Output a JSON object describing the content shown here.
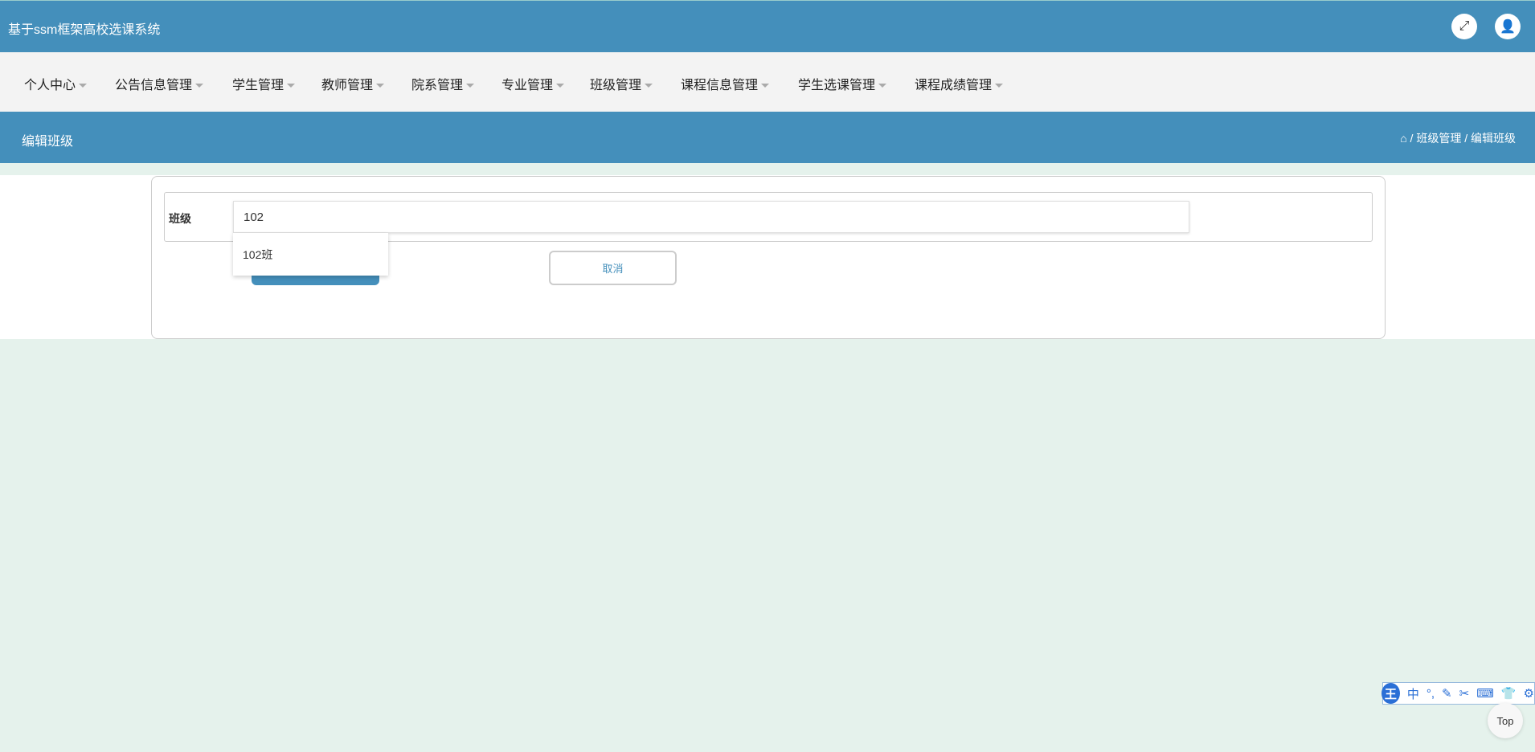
{
  "header": {
    "title": "基于ssm框架高校选课系统",
    "fullscreen_icon": "expand-icon",
    "user_icon": "user-icon"
  },
  "nav": [
    "个人中心",
    "公告信息管理",
    "学生管理",
    "教师管理",
    "院系管理",
    "专业管理",
    "班级管理",
    "课程信息管理",
    "学生选课管理",
    "课程成绩管理"
  ],
  "page": {
    "title": "编辑班级",
    "breadcrumb": [
      "班级管理",
      "编辑班级"
    ],
    "sep": "/"
  },
  "form": {
    "label": "班级",
    "value": "102",
    "suggestion": "102班",
    "cancel": "取消"
  },
  "ime": {
    "logo": "王",
    "items": [
      "中",
      "°,",
      "✎",
      "✂",
      "⌨",
      "👕",
      "⚙"
    ]
  },
  "top_button": "Top"
}
